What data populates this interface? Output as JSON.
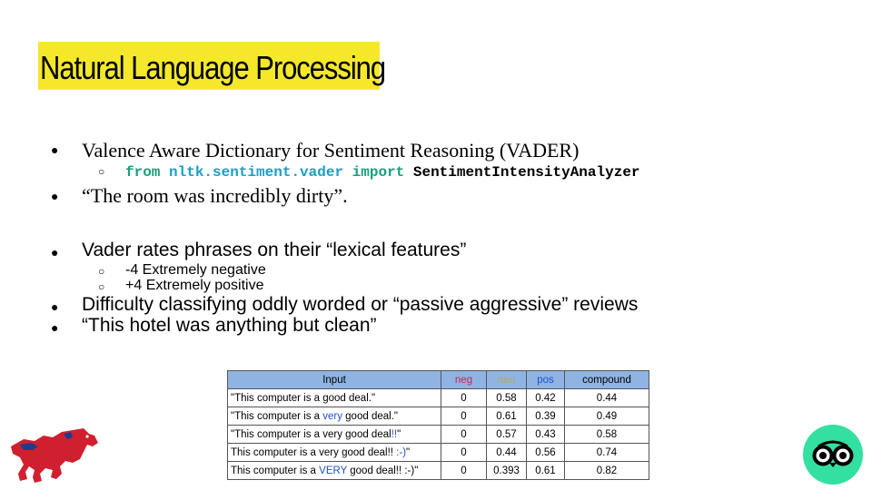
{
  "slide": {
    "title": "Natural Language Processing",
    "bullets_serif": [
      "Valence Aware Dictionary for Sentiment Reasoning (VADER)",
      "“The room was incredibly dirty”."
    ],
    "code": {
      "kw_from": "from",
      "module": "nltk.sentiment.vader",
      "kw_import": "import",
      "class_name": "SentimentIntensityAnalyzer"
    },
    "bullets_sans": [
      "Vader rates phrases on their “lexical features”",
      "Difficulty classifying oddly worded or “passive aggressive” reviews",
      "“This hotel was anything but clean”"
    ],
    "sub_bullets": [
      "-4 Extremely negative",
      "+4 Extremely positive"
    ],
    "bullet_glyph": "●",
    "sub_bullet_glyph": "○"
  },
  "table": {
    "headers": [
      "Input",
      "neg",
      "neu",
      "pos",
      "compound"
    ],
    "header_colors": {
      "neg": "#d0204c",
      "neu": "#b8a850",
      "pos": "#1f4fc9"
    },
    "rows": [
      {
        "pre": "\"This computer is a good deal.\"",
        "hl": "",
        "post": "",
        "neg": "0",
        "neu": "0.58",
        "pos": "0.42",
        "compound": "0.44"
      },
      {
        "pre": "\"This computer is a ",
        "hl": "very",
        "post": " good deal.\"",
        "neg": "0",
        "neu": "0.61",
        "pos": "0.39",
        "compound": "0.49"
      },
      {
        "pre": "\"This computer is a very good deal",
        "hl": "!!",
        "post": "\"",
        "neg": "0",
        "neu": "0.57",
        "pos": "0.43",
        "compound": "0.58"
      },
      {
        "pre": "This computer is a very good deal!! ",
        "hl": ":-)",
        "post": "\"",
        "neg": "0",
        "neu": "0.44",
        "pos": "0.56",
        "compound": "0.74"
      },
      {
        "pre": "This computer is a ",
        "hl": "VERY",
        "post": " good deal!! :-)\"",
        "neg": "0",
        "neu": "0.393",
        "pos": "0.61",
        "compound": "0.82"
      }
    ]
  },
  "logos": {
    "left": "smu-mustang-logo",
    "right": "tripadvisor-owl-logo"
  }
}
